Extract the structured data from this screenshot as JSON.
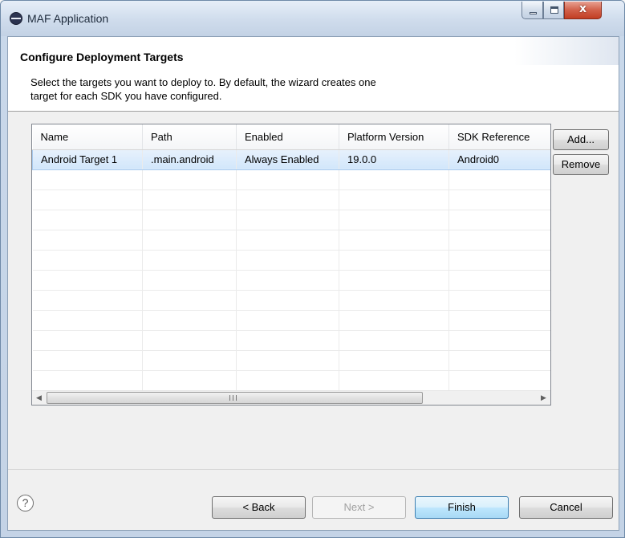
{
  "window": {
    "title": "MAF Application",
    "close_glyph": "x"
  },
  "header": {
    "title": "Configure Deployment Targets",
    "description_line1": "Select the targets you want to deploy to.  By default, the wizard creates one",
    "description_line2": "target for each SDK you have configured."
  },
  "table": {
    "columns": [
      "Name",
      "Path",
      "Enabled",
      "Platform Version",
      "SDK Reference"
    ],
    "rows": [
      [
        "Android Target 1",
        ".main.android",
        "Always Enabled",
        "19.0.0",
        "Android0"
      ]
    ],
    "scroll_grip": "III"
  },
  "side_buttons": {
    "add": "Add...",
    "remove": "Remove"
  },
  "footer": {
    "help": "?",
    "back": "< Back",
    "next": "Next >",
    "finish": "Finish",
    "cancel": "Cancel"
  },
  "icons": [
    "app-icon",
    "minimize-icon",
    "maximize-icon",
    "close-icon",
    "help-icon",
    "scroll-left-icon",
    "scroll-right-icon"
  ],
  "colors": {
    "selection": "#d1e6fb",
    "finish_border": "#3c7fb1",
    "close_button": "#c23e23"
  }
}
